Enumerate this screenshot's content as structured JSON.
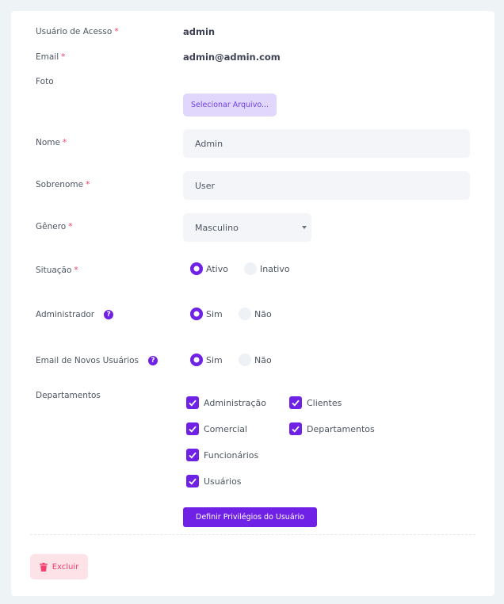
{
  "form": {
    "usuario_acesso": {
      "label": "Usuário de Acesso",
      "required": "*",
      "value": "admin"
    },
    "email": {
      "label": "Email",
      "required": "*",
      "value": "admin@admin.com"
    },
    "foto": {
      "label": "Foto",
      "button": "Selecionar Arquivo..."
    },
    "nome": {
      "label": "Nome",
      "required": "*",
      "value": "Admin"
    },
    "sobrenome": {
      "label": "Sobrenome",
      "required": "*",
      "value": "User"
    },
    "genero": {
      "label": "Gênero",
      "required": "*",
      "value": "Masculino"
    },
    "situacao": {
      "label": "Situação",
      "required": "*",
      "options": [
        "Ativo",
        "Inativo"
      ],
      "selected": "Ativo"
    },
    "administrador": {
      "label": "Administrador",
      "help": "?",
      "options": [
        "Sim",
        "Não"
      ],
      "selected": "Sim"
    },
    "email_novos": {
      "label": "Email de Novos Usuários",
      "help": "?",
      "options": [
        "Sim",
        "Não"
      ],
      "selected": "Sim"
    },
    "departamentos": {
      "label": "Departamentos",
      "items": [
        {
          "label": "Administração",
          "checked": true
        },
        {
          "label": "Clientes",
          "checked": true
        },
        {
          "label": "Comercial",
          "checked": true
        },
        {
          "label": "Departamentos",
          "checked": true
        },
        {
          "label": "Funcionários",
          "checked": true
        },
        {
          "label": "Usuários",
          "checked": true
        }
      ]
    },
    "privileges_button": "Definir Privilégios do Usuário"
  },
  "footer": {
    "delete_button": "Excluir"
  },
  "colors": {
    "accent": "#6f21e6",
    "danger": "#f1416c",
    "danger_light": "#fde3e8",
    "accent_light": "#e1d6fb"
  },
  "icons": {
    "help": "question-circle-icon",
    "delete": "trash-icon",
    "check": "checkmark-icon",
    "select": "caret-down-icon"
  }
}
